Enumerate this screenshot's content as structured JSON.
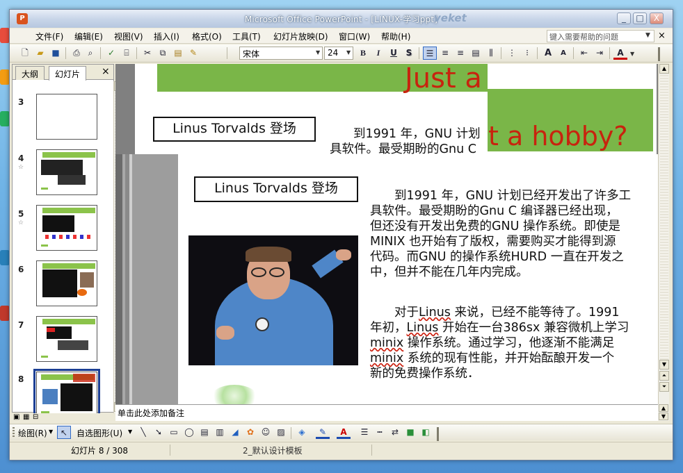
{
  "window": {
    "title": "Microsoft Office PowerPoint - [LINUX-学习ppt]",
    "watermark": "veket",
    "controls": [
      "_",
      "□",
      "X"
    ]
  },
  "menubar": {
    "items": [
      "文件(F)",
      "编辑(E)",
      "视图(V)",
      "插入(I)",
      "格式(O)",
      "工具(T)",
      "幻灯片放映(D)",
      "窗口(W)",
      "帮助(H)"
    ],
    "help_placeholder": "键入需要帮助的问题",
    "close": "×"
  },
  "toolbar": {
    "font_name": "宋体",
    "font_size": "24",
    "bold": "B",
    "italic": "I",
    "underline": "U",
    "shadow": "S",
    "grow_font": "A",
    "shrink_font": "A",
    "font_color": "A"
  },
  "left_pane": {
    "tabs": [
      "大纲",
      "幻灯片"
    ],
    "close": "×",
    "thumbnails": [
      {
        "num": "3",
        "star": ""
      },
      {
        "num": "4",
        "star": "☆"
      },
      {
        "num": "5",
        "star": "☆"
      },
      {
        "num": "6",
        "star": ""
      },
      {
        "num": "7",
        "star": ""
      },
      {
        "num": "8",
        "star": ""
      }
    ]
  },
  "slide": {
    "title_top": "Just a",
    "title_hobby": "t a hobby?",
    "label_back": "Linus Torvalds 登场",
    "back_line1": "到1991 年，GNU 计划",
    "back_line2": "具软件。最受期盼的Gnu C",
    "label_front": "Linus Torvalds 登场",
    "para1": [
      "　　到1991 年，GNU 计划已经开发出了许多工",
      "具软件。最受期盼的Gnu C 编译器已经出现，",
      "但还没有开发出免费的GNU 操作系统。即使是",
      "MINIX 也开始有了版权，需要购买才能得到源",
      "代码。而GNU 的操作系统HURD 一直在开发之",
      "中，但并不能在几年内完成。"
    ],
    "para2_l1a": "　　对于",
    "para2_l1b": "Linus",
    "para2_l1c": " 来说，已经不能等待了。1991",
    "para2_l2a": "年初，",
    "para2_l2b": "Linus",
    "para2_l2c": " 开始在一台386sx 兼容微机上学习",
    "para2_l3a": "minix",
    "para2_l3b": " 操作系统。通过学习，他逐渐不能满足",
    "para2_l4a": "minix",
    "para2_l4b": " 系统的现有性能，并开始酝酿开发一个",
    "para2_l5": "新的免费操作系统．"
  },
  "notes": {
    "placeholder": "单击此处添加备注"
  },
  "drawbar": {
    "draw": "绘图(R)",
    "autoshapes": "自选图形(U)"
  },
  "statusbar": {
    "slide_pos": "幻灯片 8 / 308",
    "template": "2_默认设计模板"
  },
  "colors": {
    "title_red": "#c8230e",
    "slide_green": "#7ab648",
    "selection_blue": "#1c3f94"
  }
}
